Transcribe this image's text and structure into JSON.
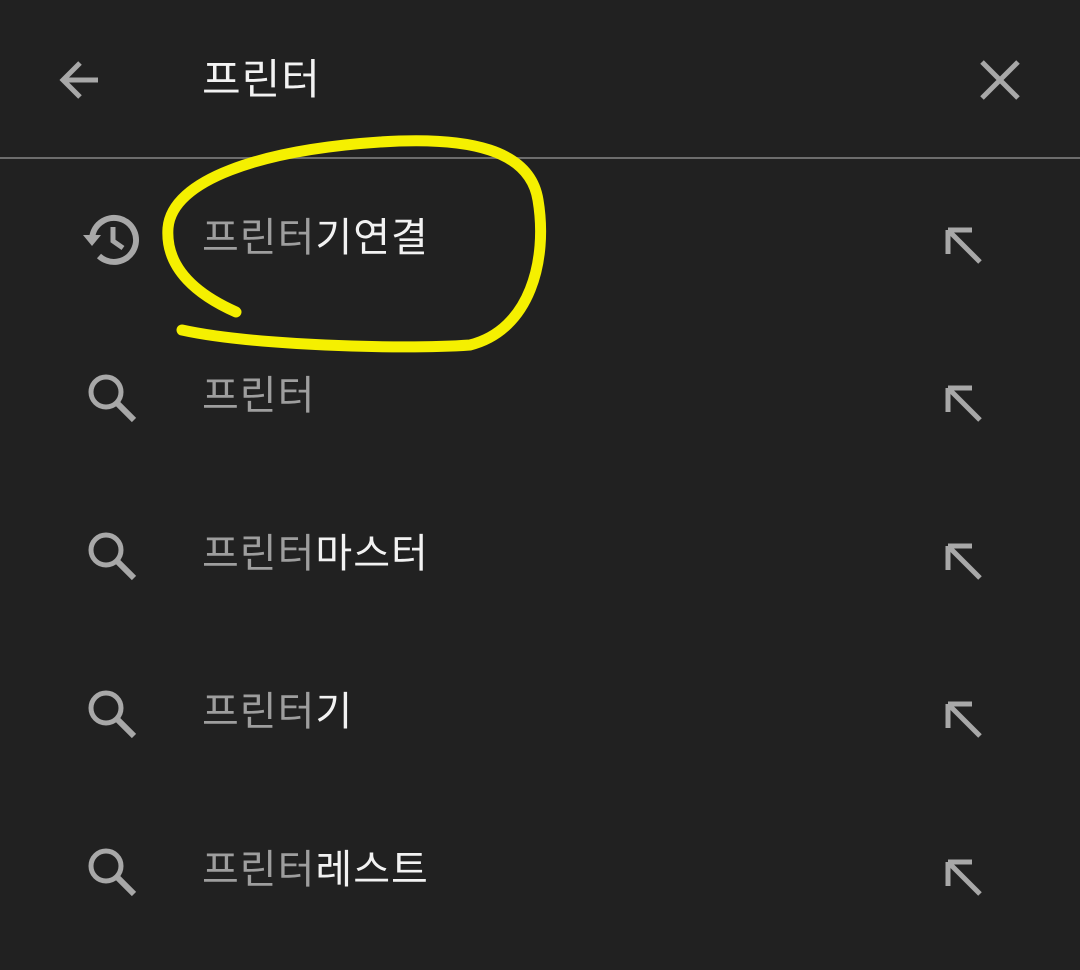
{
  "search": {
    "query": "프린터",
    "back_icon": "arrow-back-icon",
    "clear_icon": "close-icon"
  },
  "suggestions": [
    {
      "type": "history",
      "icon": "history-icon",
      "prefix": "프린터",
      "suffix": "기연결",
      "fill_icon": "arrow-up-left-icon"
    },
    {
      "type": "search",
      "icon": "search-icon",
      "prefix": "프린터",
      "suffix": "",
      "fill_icon": "arrow-up-left-icon"
    },
    {
      "type": "search",
      "icon": "search-icon",
      "prefix": "프린터",
      "suffix": "마스터",
      "fill_icon": "arrow-up-left-icon"
    },
    {
      "type": "search",
      "icon": "search-icon",
      "prefix": "프린터",
      "suffix": "기",
      "fill_icon": "arrow-up-left-icon"
    },
    {
      "type": "search",
      "icon": "search-icon",
      "prefix": "프린터",
      "suffix": "레스트",
      "fill_icon": "arrow-up-left-icon"
    }
  ],
  "colors": {
    "background": "#212121",
    "query_text": "#f2f2f2",
    "matched_prefix": "#9e9e9e",
    "suggestion_suffix": "#f2f2f2",
    "icon": "#a8a8a8",
    "divider": "#6d6d6d",
    "annotation_highlight": "#f5f000"
  }
}
